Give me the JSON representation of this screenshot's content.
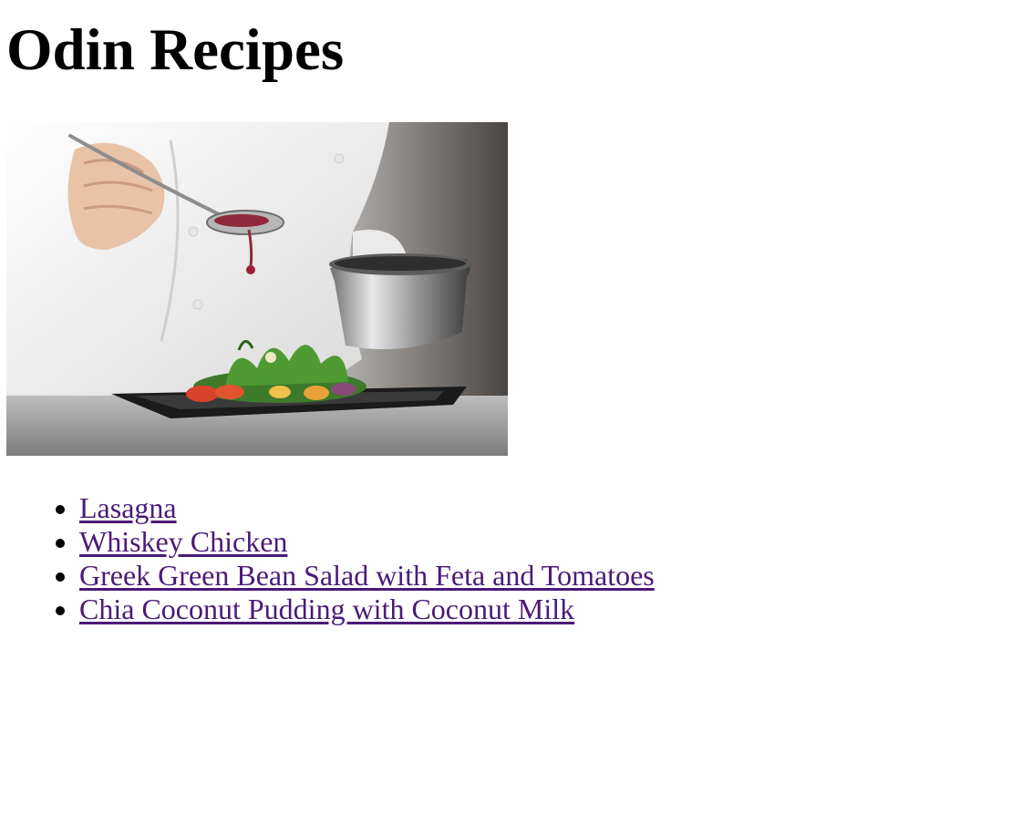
{
  "page": {
    "title": "Odin Recipes"
  },
  "hero_image": {
    "alt": "Chef plating a salad with a drizzle of sauce"
  },
  "recipes": [
    {
      "label": "Lasagna"
    },
    {
      "label": "Whiskey Chicken"
    },
    {
      "label": "Greek Green Bean Salad with Feta and Tomatoes"
    },
    {
      "label": "Chia Coconut Pudding with Coconut Milk"
    }
  ],
  "colors": {
    "link_visited": "#4b1a78",
    "text": "#000000",
    "background": "#ffffff"
  }
}
